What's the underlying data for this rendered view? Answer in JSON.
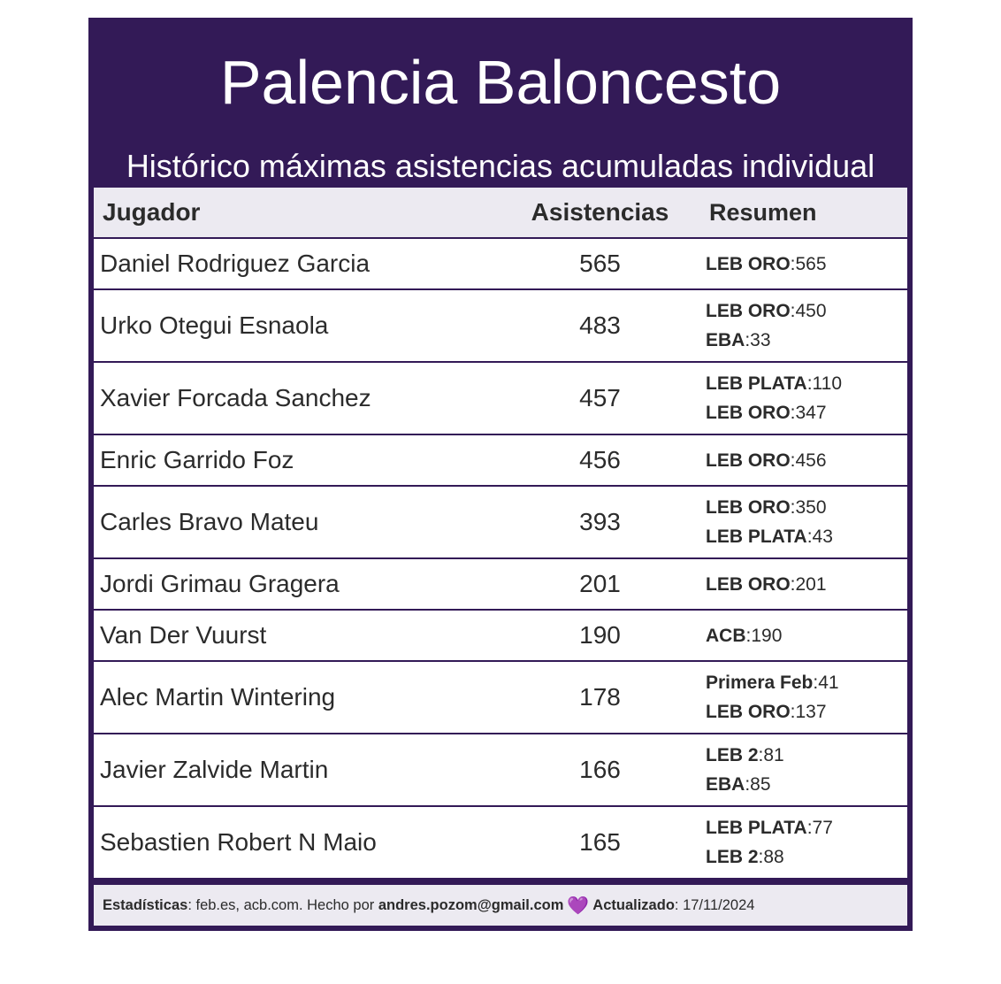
{
  "title": "Palencia Baloncesto",
  "subtitle": "Histórico máximas asistencias acumuladas individual",
  "headers": {
    "player": "Jugador",
    "assists": "Asistencias",
    "summary": "Resumen"
  },
  "rows": [
    {
      "player": "Daniel Rodriguez Garcia",
      "assists": "565",
      "summary": [
        {
          "league": "LEB ORO",
          "value": ":565"
        }
      ]
    },
    {
      "player": "Urko Otegui Esnaola",
      "assists": "483",
      "summary": [
        {
          "league": "LEB ORO",
          "value": ":450"
        },
        {
          "league": "EBA",
          "value": ":33"
        }
      ]
    },
    {
      "player": "Xavier Forcada Sanchez",
      "assists": "457",
      "summary": [
        {
          "league": "LEB PLATA",
          "value": ":110"
        },
        {
          "league": "LEB ORO",
          "value": ":347"
        }
      ]
    },
    {
      "player": "Enric Garrido Foz",
      "assists": "456",
      "summary": [
        {
          "league": "LEB ORO",
          "value": ":456"
        }
      ]
    },
    {
      "player": "Carles Bravo Mateu",
      "assists": "393",
      "summary": [
        {
          "league": "LEB ORO",
          "value": ":350"
        },
        {
          "league": "LEB PLATA",
          "value": ":43"
        }
      ]
    },
    {
      "player": "Jordi Grimau Gragera",
      "assists": "201",
      "summary": [
        {
          "league": "LEB ORO",
          "value": ":201"
        }
      ]
    },
    {
      "player": "Van Der Vuurst",
      "assists": "190",
      "summary": [
        {
          "league": "ACB",
          "value": ":190"
        }
      ]
    },
    {
      "player": "Alec Martin Wintering",
      "assists": "178",
      "summary": [
        {
          "league": "Primera Feb",
          "value": ":41"
        },
        {
          "league": "LEB ORO",
          "value": ":137"
        }
      ]
    },
    {
      "player": "Javier Zalvide Martin",
      "assists": "166",
      "summary": [
        {
          "league": "LEB 2",
          "value": ":81"
        },
        {
          "league": "EBA",
          "value": ":85"
        }
      ]
    },
    {
      "player": "Sebastien Robert N Maio",
      "assists": "165",
      "summary": [
        {
          "league": "LEB PLATA",
          "value": ":77"
        },
        {
          "league": "LEB 2",
          "value": ":88"
        }
      ]
    }
  ],
  "footer": {
    "stats_label": "Estadísticas",
    "stats_text": ": feb.es, acb.com. Hecho por ",
    "email": "andres.pozom@gmail.com",
    "heart": "💜",
    "updated_label": "Actualizado",
    "updated_text": ": 17/11/2024"
  },
  "colors": {
    "brand": "#331a57",
    "header_bg": "#eceaf1",
    "heart": "#9b30d9"
  }
}
